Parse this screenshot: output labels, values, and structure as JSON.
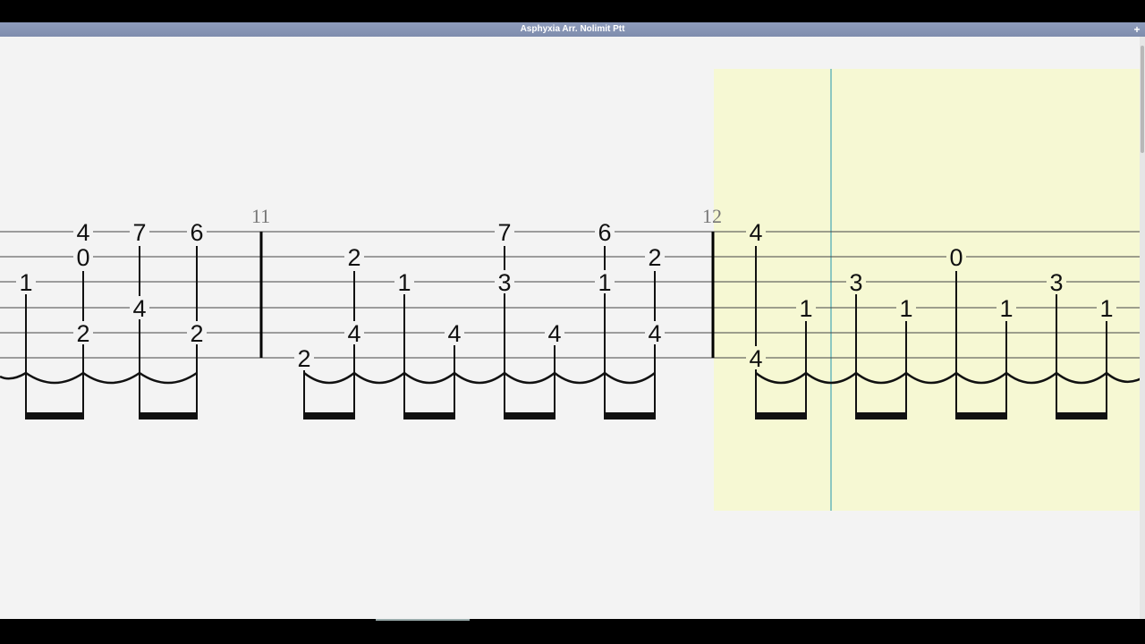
{
  "window": {
    "title": "Asphyxia Arr. Nolimit Ptt",
    "plus_label": "+"
  },
  "colors": {
    "titlebar": "#8392b2",
    "background": "#f3f3f3",
    "highlight": "#f6f8d3",
    "cursor": "#8cc7c0",
    "ink": "#111111"
  },
  "tab": {
    "strings": 6,
    "measures": [
      {
        "number": "11"
      },
      {
        "number": "12"
      }
    ],
    "notes": [
      {
        "fret": "1",
        "string": 3
      },
      {
        "fret": "4",
        "string": 1
      },
      {
        "fret": "0",
        "string": 2
      },
      {
        "fret": "2",
        "string": 5
      },
      {
        "fret": "7",
        "string": 1
      },
      {
        "fret": "4",
        "string": 4
      },
      {
        "fret": "6",
        "string": 1
      },
      {
        "fret": "2",
        "string": 5
      },
      {
        "fret": "2",
        "string": 6
      },
      {
        "fret": "2",
        "string": 2
      },
      {
        "fret": "4",
        "string": 5
      },
      {
        "fret": "1",
        "string": 3
      },
      {
        "fret": "4",
        "string": 5
      },
      {
        "fret": "7",
        "string": 1
      },
      {
        "fret": "3",
        "string": 3
      },
      {
        "fret": "4",
        "string": 5
      },
      {
        "fret": "6",
        "string": 1
      },
      {
        "fret": "1",
        "string": 3
      },
      {
        "fret": "2",
        "string": 2
      },
      {
        "fret": "4",
        "string": 5
      },
      {
        "fret": "4",
        "string": 1
      },
      {
        "fret": "4",
        "string": 6
      },
      {
        "fret": "1",
        "string": 4
      },
      {
        "fret": "3",
        "string": 3
      },
      {
        "fret": "1",
        "string": 4
      },
      {
        "fret": "0",
        "string": 2
      },
      {
        "fret": "1",
        "string": 4
      },
      {
        "fret": "3",
        "string": 3
      },
      {
        "fret": "1",
        "string": 4
      }
    ]
  }
}
